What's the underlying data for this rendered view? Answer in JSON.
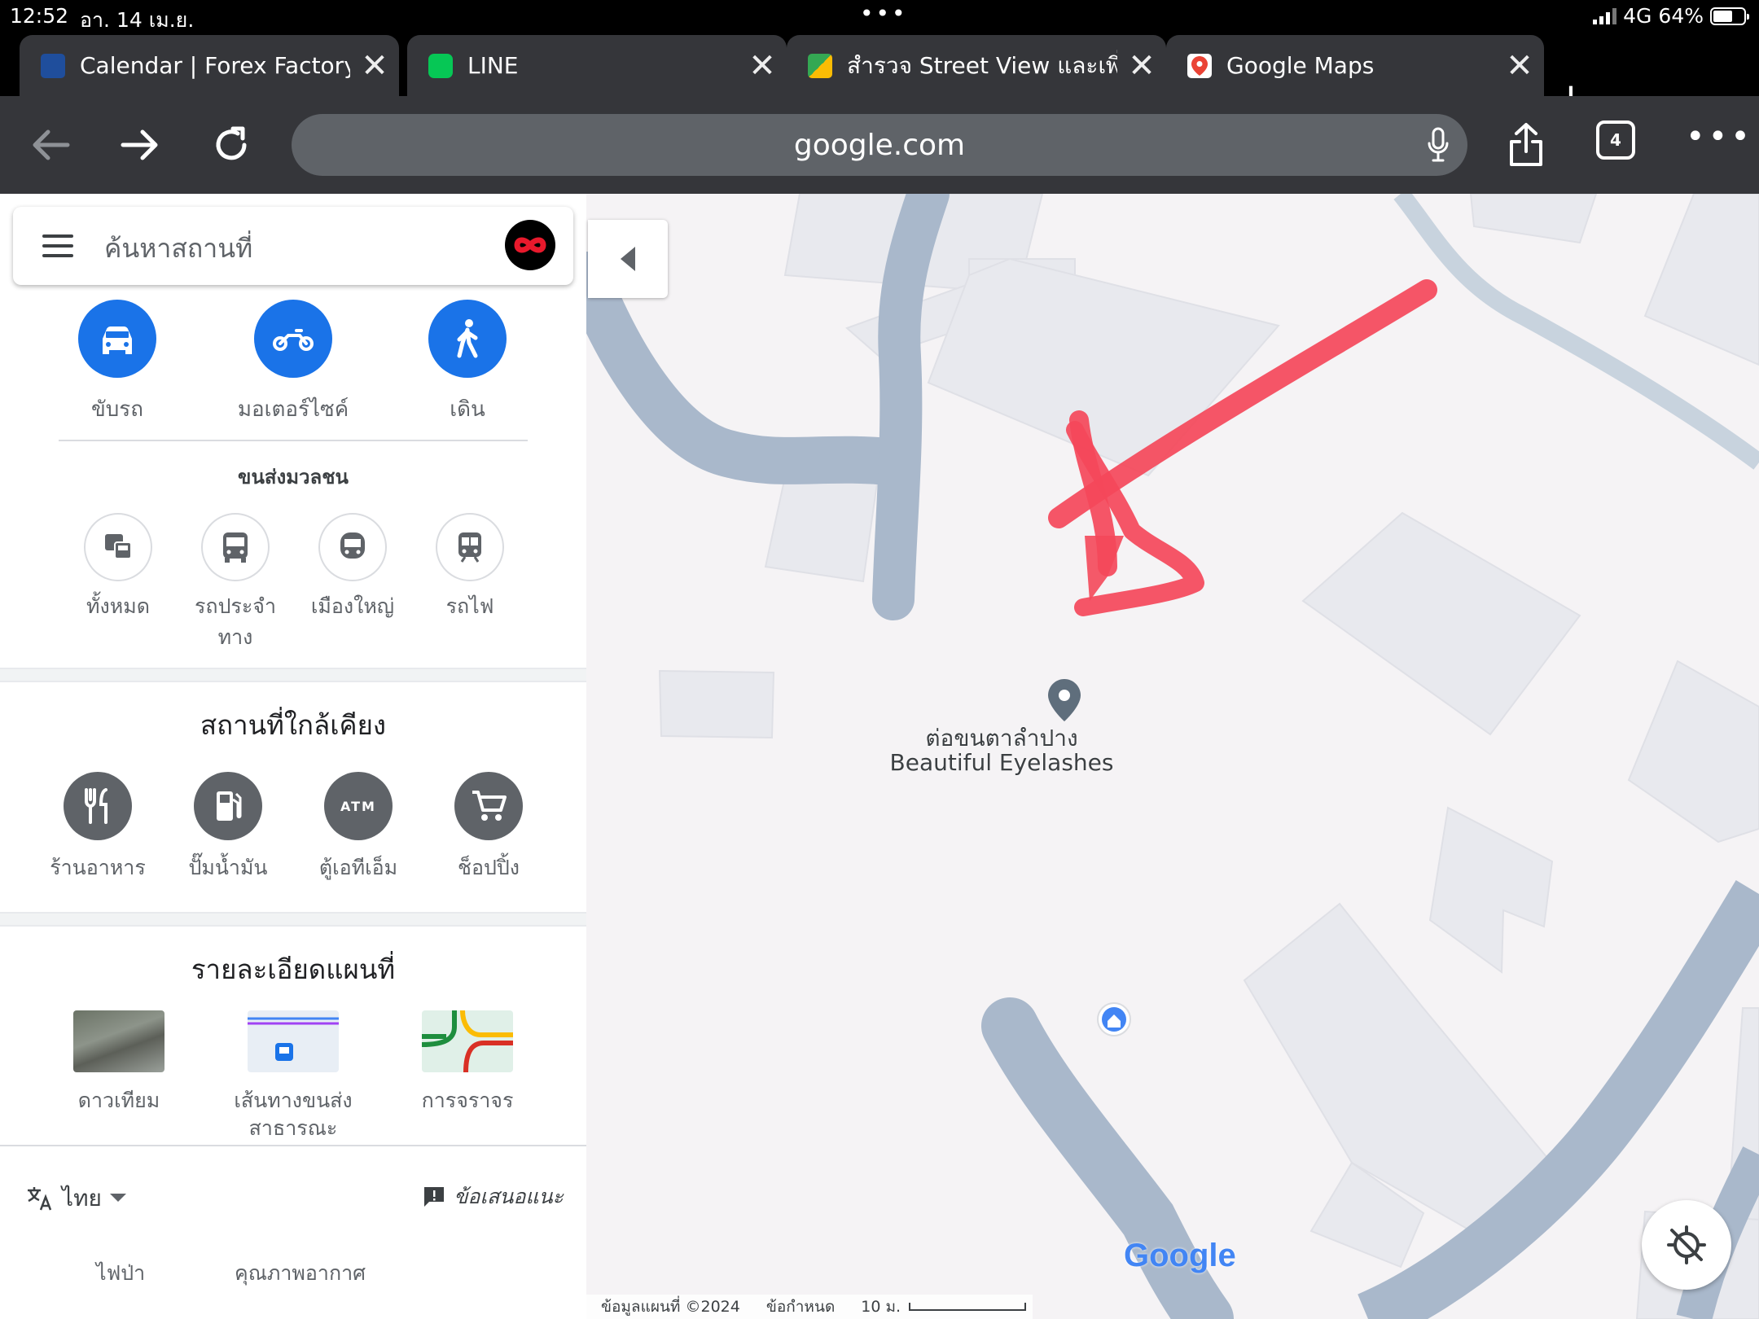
{
  "status_bar": {
    "time": "12:52",
    "date": "อา. 14 เม.ย.",
    "dots": "•••",
    "network": "4G",
    "battery": "64%",
    "battery_level": 0.64
  },
  "tabs": [
    {
      "title": "Calendar | Forex Factory",
      "close": "✕"
    },
    {
      "title": "LINE",
      "close": "✕"
    },
    {
      "title": "สำรวจ Street View และเพิ่มรูปภาพของคุณเอง",
      "close": "✕"
    },
    {
      "title": "Google Maps",
      "close": "✕",
      "active": true
    }
  ],
  "toolbar": {
    "new_tab": "+",
    "url": "google.com",
    "tab_count": "4",
    "more": "•••"
  },
  "maps_panel": {
    "search_placeholder": "ค้นหาสถานที่",
    "travel_modes": [
      "ขับรถ",
      "มอเตอร์ไซค์",
      "เดิน"
    ],
    "transit_title": "ขนส่งมวลชน",
    "transit_options": [
      "ทั้งหมด",
      "รถประจำทาง",
      "เมืองใหญ่",
      "รถไฟ"
    ],
    "nearby_title": "สถานที่ใกล้เคียง",
    "nearby": [
      {
        "label": "ร้านอาหาร",
        "icon": "restaurant-icon"
      },
      {
        "label": "ปั๊มน้ำมัน",
        "icon": "gas-station-icon"
      },
      {
        "label": "ตู้เอทีเอ็ม",
        "icon": "atm-icon",
        "icon_text": "ATM"
      },
      {
        "label": "ช็อปปิ้ง",
        "icon": "shopping-cart-icon"
      }
    ],
    "map_details_title": "รายละเอียดแผนที่",
    "map_details": [
      "ดาวเทียม",
      "เส้นทางขนส่งสาธารณะ",
      "การจราจร"
    ],
    "language": "ไทย",
    "feedback": "ข้อเสนอแนะ",
    "links": [
      "ไฟป่า",
      "คุณภาพอากาศ"
    ]
  },
  "map": {
    "place_name_th": "ต่อขนตาลำปาง",
    "place_name_en": "Beautiful Eyelashes",
    "google_logo": "Google",
    "map_data": "ข้อมูลแผนที่ ©2024",
    "terms": "ข้อกำหนด",
    "scale": "10 ม."
  },
  "colors": {
    "accent": "#1a73e8",
    "arrow": "#f4485a",
    "road": "#a9b8cb"
  }
}
